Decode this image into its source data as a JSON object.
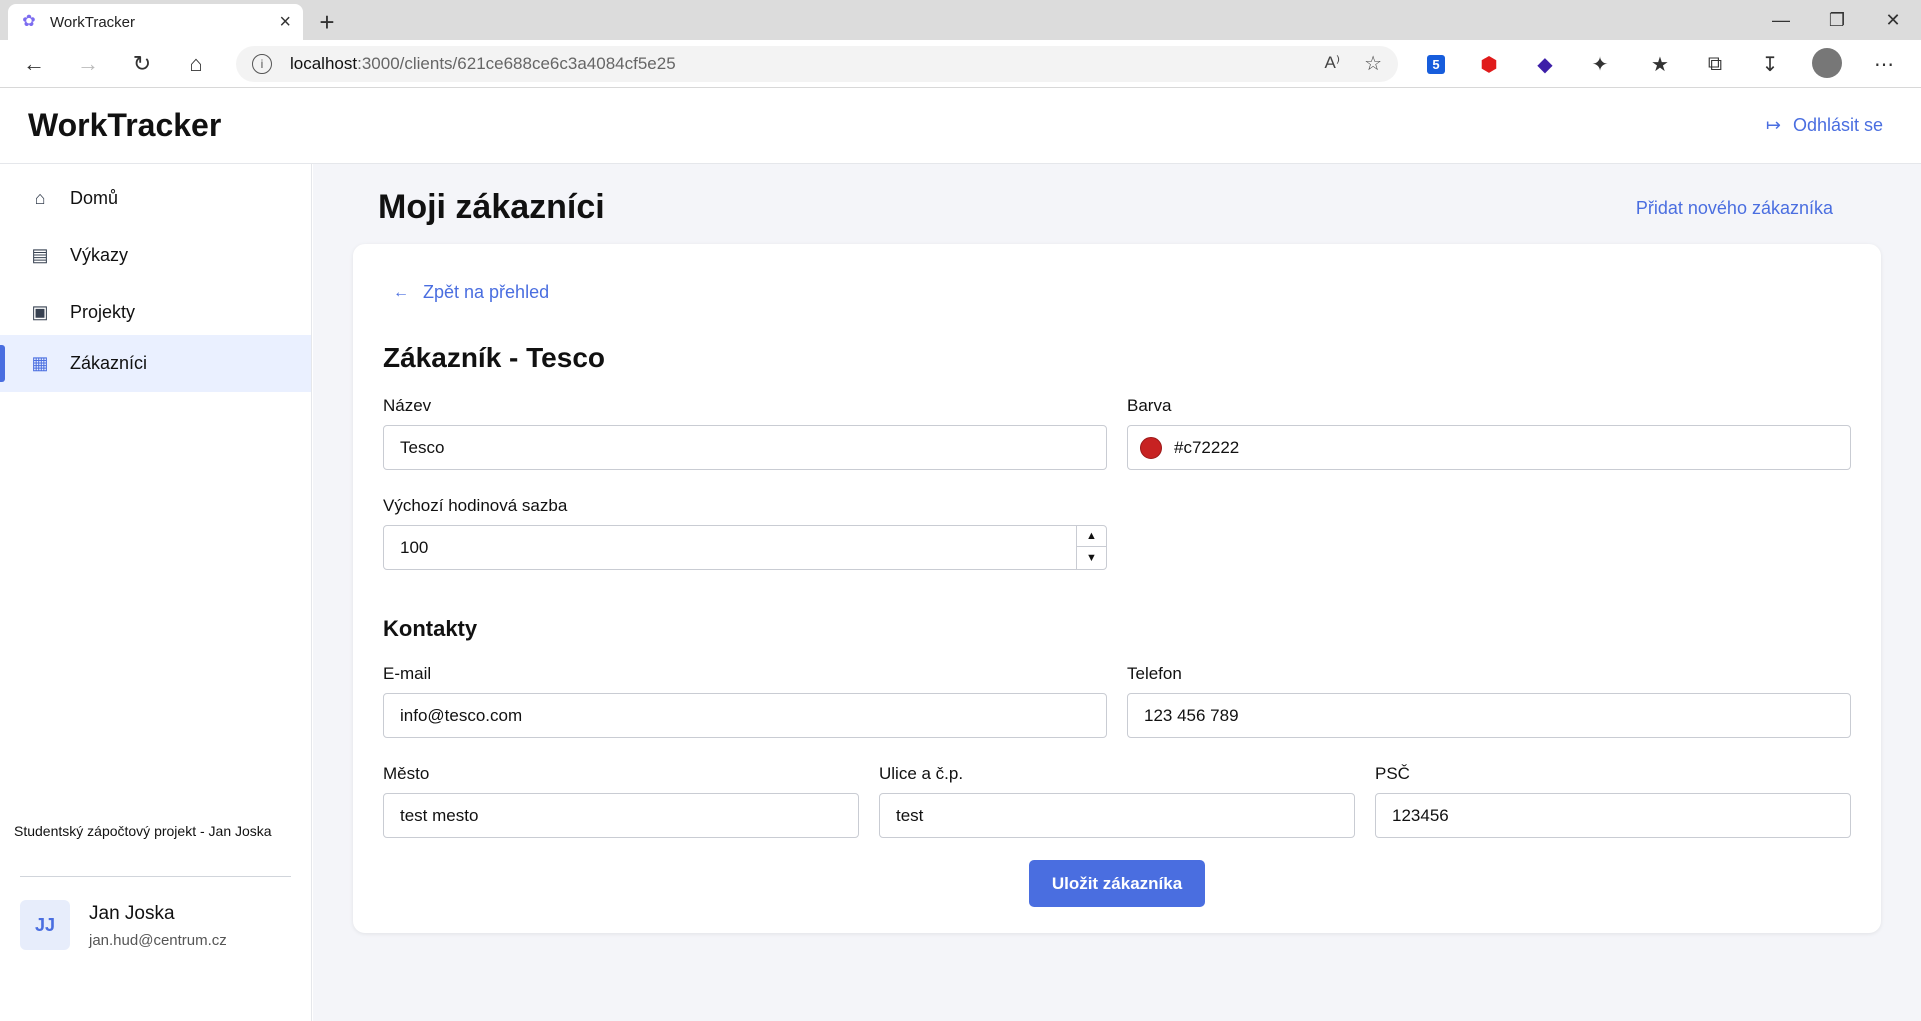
{
  "browser": {
    "tab_title": "WorkTracker",
    "url_host": "localhost",
    "url_path": ":3000/clients/621ce688ce6c3a4084cf5e25",
    "extension_badge": "5"
  },
  "header": {
    "brand": "WorkTracker",
    "logout_label": "Odhlásit se"
  },
  "sidebar": {
    "items": [
      {
        "label": "Domů",
        "icon": "home-icon"
      },
      {
        "label": "Výkazy",
        "icon": "briefcase-icon"
      },
      {
        "label": "Projekty",
        "icon": "folder-stack-icon"
      },
      {
        "label": "Zákazníci",
        "icon": "storefront-icon"
      }
    ],
    "active_index": 3,
    "user": {
      "initials": "JJ",
      "name": "Jan Joska",
      "email": "jan.hud@centrum.cz"
    },
    "footer": "Studentský zápočtový projekt - Jan Joska"
  },
  "main": {
    "title": "Moji zákazníci",
    "add_link": "Přidat nového zákazníka",
    "back_link": "Zpět na přehled",
    "heading": "Zákazník - Tesco",
    "contacts_heading": "Kontakty",
    "save_label": "Uložit zákazníka",
    "accent_color": "#4a6ee0"
  },
  "form": {
    "name_label": "Název",
    "name_value": "Tesco",
    "color_label": "Barva",
    "color_value": "#c72222",
    "rate_label": "Výchozí hodinová sazba",
    "rate_value": "100",
    "email_label": "E-mail",
    "email_value": "info@tesco.com",
    "phone_label": "Telefon",
    "phone_value": "123 456 789",
    "city_label": "Město",
    "city_value": "test mesto",
    "street_label": "Ulice a č.p.",
    "street_value": "test",
    "zip_label": "PSČ",
    "zip_value": "123456"
  }
}
